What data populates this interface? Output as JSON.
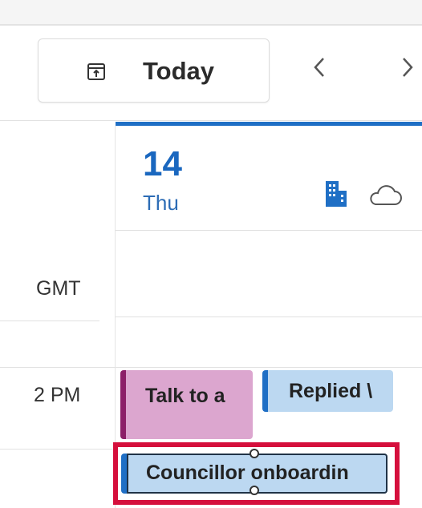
{
  "toolbar": {
    "today_label": "Today",
    "prev_glyph": "‹",
    "next_glyph": "›"
  },
  "day_header": {
    "day_number": "14",
    "day_name": "Thu",
    "icons": [
      "building-icon",
      "cloud-icon"
    ]
  },
  "timezone_label": "GMT",
  "time_labels": [
    "2 PM"
  ],
  "events": [
    {
      "title": "Talk to a",
      "color": "#dca6cf",
      "accent": "#8c1f68"
    },
    {
      "title": "Replied \\",
      "color": "#bcd8f1",
      "accent": "#1f6fc5"
    },
    {
      "title": "Councillor onboardin",
      "color": "#bcd8f1",
      "accent": "#1f6fc5",
      "selected": true
    }
  ],
  "colors": {
    "today_accent": "#1f6fc5",
    "highlight": "#d50f3c"
  }
}
